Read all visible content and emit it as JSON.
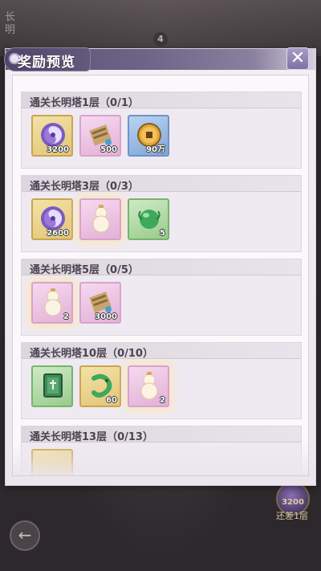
{
  "background": {
    "side_text": "长明",
    "floor_number": "4",
    "remaining_reward_count": "3200",
    "remaining_label": "还差1层"
  },
  "dialog": {
    "title": "奖励预览",
    "close_icon": "close-x-icon"
  },
  "sections": [
    {
      "title": "通关长明塔1层（0/1）",
      "items": [
        {
          "icon": "purple-swirl-orb-icon",
          "quantity": "3200",
          "style": "gold"
        },
        {
          "icon": "scroll-icon",
          "quantity": "500",
          "style": "pink"
        },
        {
          "icon": "copper-coin-icon",
          "quantity": "90万",
          "style": "blue"
        }
      ]
    },
    {
      "title": "通关长明塔3层（0/3）",
      "items": [
        {
          "icon": "purple-swirl-orb-icon",
          "quantity": "2600",
          "style": "gold"
        },
        {
          "icon": "gourd-icon",
          "quantity": "",
          "style": "pink"
        },
        {
          "icon": "green-jade-bead-icon",
          "quantity": "5",
          "style": "green"
        }
      ]
    },
    {
      "title": "通关长明塔5层（0/5）",
      "items": [
        {
          "icon": "gourd-icon",
          "quantity": "2",
          "style": "pink"
        },
        {
          "icon": "scroll-icon",
          "quantity": "3000",
          "style": "pink"
        }
      ]
    },
    {
      "title": "通关长明塔10层（0/10）",
      "items": [
        {
          "icon": "green-book-icon",
          "quantity": "",
          "style": "green"
        },
        {
          "icon": "jade-dragon-icon",
          "quantity": "60",
          "style": "gold"
        },
        {
          "icon": "gourd-icon",
          "quantity": "2",
          "style": "pink"
        }
      ]
    },
    {
      "title": "通关长明塔13层（0/13）",
      "items": []
    }
  ]
}
